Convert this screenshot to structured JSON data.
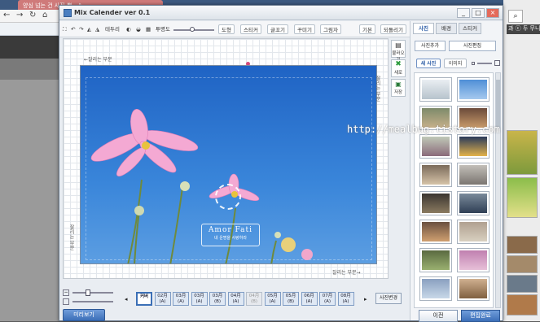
{
  "browser": {
    "tab_title": "양심 넘는 건 사진 뿐 - ♪",
    "right_snippet": "과 ⓒ 두 무니..",
    "right_search_icon": "search-icon"
  },
  "app": {
    "title": "Mix Calender ver 0.1",
    "window_buttons": [
      "_",
      "□",
      "×"
    ]
  },
  "toolbar": {
    "edge_label": "테두리",
    "brightness_label": "투명도",
    "btn_shape": "도형",
    "btn_sticker": "스티커",
    "btn_text": "글꼬기",
    "btn_deco": "꾸미기",
    "btn_copy": "그림자",
    "btn_save_layout": "기본",
    "btn_back": "되돌리기"
  },
  "canvas": {
    "guide_top": "←잘리는 부분",
    "guide_bottom": "잘리는 부분→",
    "guide_right": "잘리는 부분",
    "guide_left": "잘리는 부분",
    "card_title": "Amor Fati",
    "card_sub": "네 운명을 사랑하라"
  },
  "side_tools": [
    "불러오기",
    "새로",
    "저장"
  ],
  "bottom": {
    "months": [
      {
        "label": "커버",
        "sub": ""
      },
      {
        "label": "02月",
        "sub": "(A)"
      },
      {
        "label": "03月",
        "sub": "(A)"
      },
      {
        "label": "03月",
        "sub": "(A)"
      },
      {
        "label": "03月",
        "sub": "(B)"
      },
      {
        "label": "04月",
        "sub": "(A)"
      },
      {
        "label": "04月",
        "sub": "(B)"
      },
      {
        "label": "05月",
        "sub": "(A)"
      },
      {
        "label": "05月",
        "sub": "(B)"
      },
      {
        "label": "06月",
        "sub": "(A)"
      },
      {
        "label": "07月",
        "sub": "(A)"
      },
      {
        "label": "08月",
        "sub": "(A)"
      }
    ],
    "right_button": "사진변경",
    "preview_button": "미리보기"
  },
  "panel": {
    "tabs": [
      "사진",
      "배경",
      "스티커"
    ],
    "btn_add_photo": "사진추가",
    "btn_edit": "사진편집",
    "subtabs": [
      "새 사진",
      "이미지"
    ],
    "cancel": "이전",
    "done": "편집완료"
  },
  "watermark": "http://mealbug.tistory.com"
}
